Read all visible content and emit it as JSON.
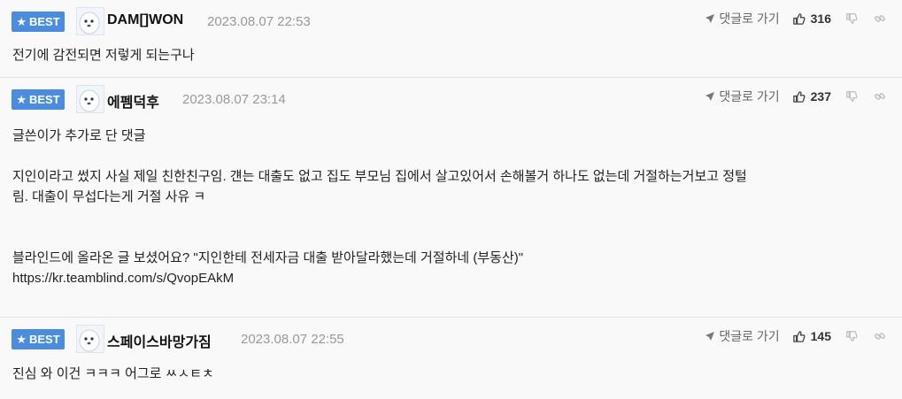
{
  "comments": [
    {
      "badge": "BEST",
      "nickname": "DAM[]WON",
      "date": "2023.08.07 22:53",
      "reply_label": "댓글로 가기",
      "likes": "316",
      "lines": [
        "전기에 감전되면 저렇게 되는구나"
      ]
    },
    {
      "badge": "BEST",
      "nickname": "에펨덕후",
      "date": "2023.08.07 23:14",
      "reply_label": "댓글로 가기",
      "likes": "237",
      "lines": [
        "글쓴이가 추가로 단 댓글",
        "지인이라고 썼지 사실 제일 친한친구임. 걘는 대출도 없고 집도 부모님 집에서 살고있어서 손해볼거 하나도 없는데 거절하는거보고 정털",
        "림. 대출이 무섭다는게 거절 사유 ㅋ",
        "블라인드에 올라온 글 보셨어요? \"지인한테 전세자금 대출 받아달라했는데 거절하네 (부동산)\"",
        "https://kr.teamblind.com/s/QvopEAkM"
      ]
    },
    {
      "badge": "BEST",
      "nickname": "스페이스바망가짐",
      "date": "2023.08.07 22:55",
      "reply_label": "댓글로 가기",
      "likes": "145",
      "lines": [
        "진심 와 이건 ㅋㅋㅋ 어그로 ㅆㅅㅌㅊ"
      ]
    }
  ],
  "colors": {
    "badge": "#4a8de0",
    "date": "#999999",
    "background": "#f9f9f9"
  },
  "icons": [
    "star-icon",
    "avatar-icon",
    "reply-arrow-icon",
    "thumbs-up-icon",
    "thumbs-down-icon",
    "link-icon"
  ]
}
